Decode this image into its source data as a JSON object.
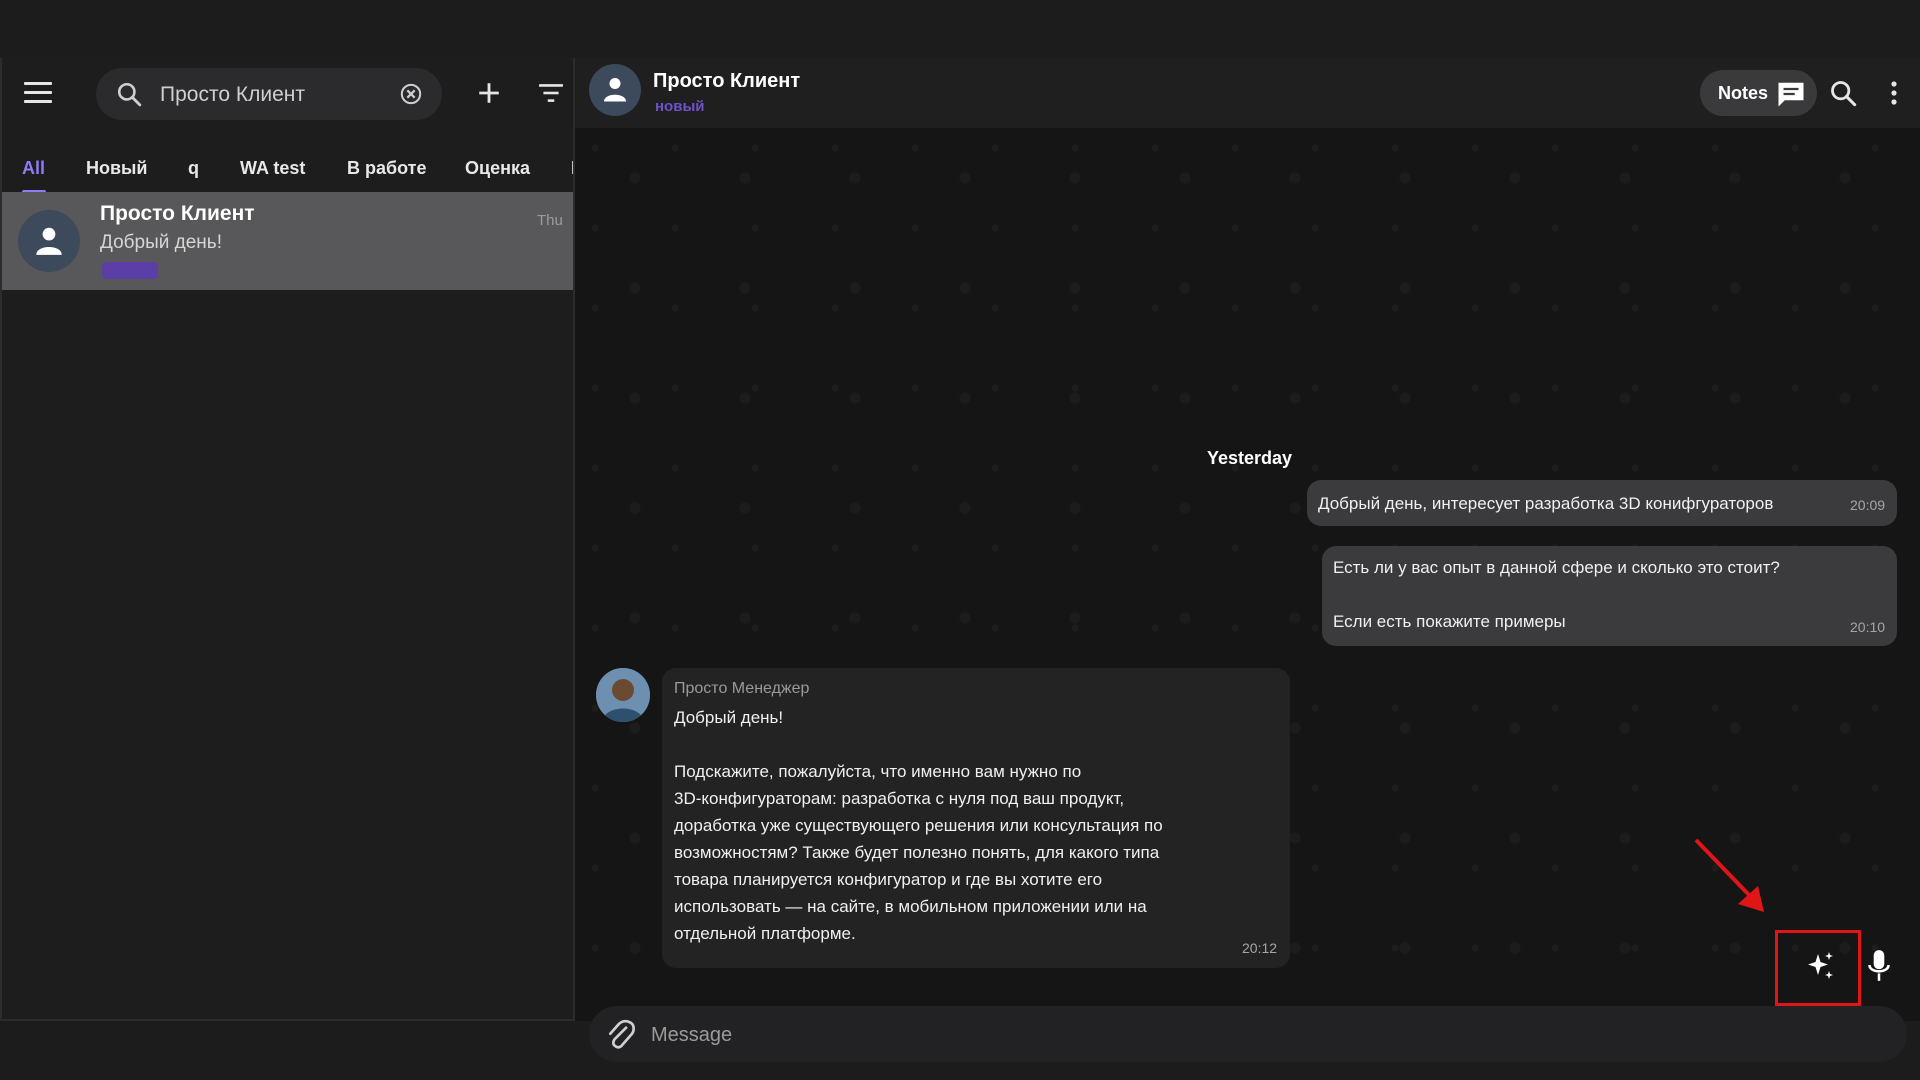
{
  "sidebar": {
    "search": {
      "value": "Просто Клиент",
      "placeholder": ""
    },
    "tabs": [
      {
        "label": "All",
        "active": true
      },
      {
        "label": "Новый"
      },
      {
        "label": "q"
      },
      {
        "label": "WA test"
      },
      {
        "label": "В работе"
      },
      {
        "label": "Оценка"
      },
      {
        "label": "К"
      }
    ],
    "chats": [
      {
        "name": "Просто Клиент",
        "preview": "Добрый день!",
        "time": "Thu"
      }
    ]
  },
  "header": {
    "name": "Просто Клиент",
    "status": "новый",
    "notes_label": "Notes"
  },
  "messages": {
    "date_separator": "Yesterday",
    "items": [
      {
        "direction": "out",
        "text": "Добрый день,  интересует разработка 3D конифгураторов",
        "time": "20:09"
      },
      {
        "direction": "out",
        "text": "Есть ли у вас опыт в данной сфере и сколько это стоит?\n\nЕсли есть покажите примеры",
        "time": "20:10"
      },
      {
        "direction": "in",
        "sender": "Просто Менеджер",
        "text": "Добрый день!\n\nПодскажите, пожалуйста, что именно вам нужно по\n3D-конфигураторам: разработка с нуля под ваш продукт,\nдоработка уже существующего решения или консультация по\nвозможностям? Также будет полезно понять, для какого типа\nтовара планируется конфигуратор и где вы хотите его\nиспользовать — на сайте, в мобильном приложении или на\nотдельной платформе.",
        "time": "20:12"
      }
    ]
  },
  "composer": {
    "placeholder": "Message",
    "value": ""
  },
  "colors": {
    "accent": "#8e7cf2",
    "status": "#6f51c9",
    "highlight": "#e01515"
  }
}
